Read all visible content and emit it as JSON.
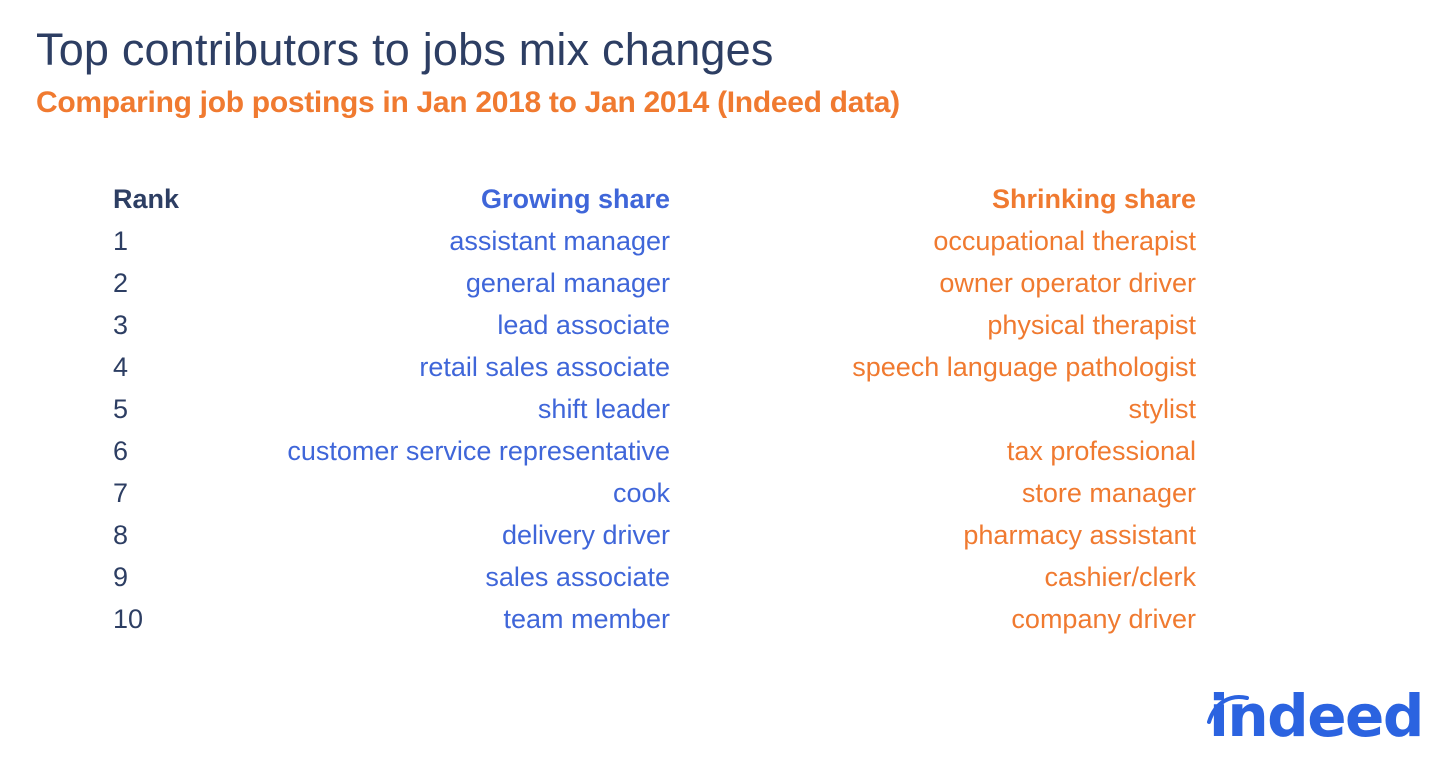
{
  "title": "Top contributors to jobs mix changes",
  "subtitle": "Comparing job postings in Jan 2018 to Jan 2014 (Indeed data)",
  "colors": {
    "title": "#2d3e63",
    "growing": "#3f66d9",
    "shrinking": "#f07a30",
    "logo": "#2b63e0"
  },
  "table": {
    "headers": {
      "rank": "Rank",
      "growing": "Growing share",
      "shrinking": "Shrinking share"
    },
    "rows": [
      {
        "rank": "1",
        "growing": "assistant manager",
        "shrinking": "occupational therapist"
      },
      {
        "rank": "2",
        "growing": "general manager",
        "shrinking": "owner operator driver"
      },
      {
        "rank": "3",
        "growing": "lead associate",
        "shrinking": "physical therapist"
      },
      {
        "rank": "4",
        "growing": "retail sales associate",
        "shrinking": "speech language pathologist"
      },
      {
        "rank": "5",
        "growing": "shift leader",
        "shrinking": "stylist"
      },
      {
        "rank": "6",
        "growing": "customer service representative",
        "shrinking": "tax professional"
      },
      {
        "rank": "7",
        "growing": "cook",
        "shrinking": "store manager"
      },
      {
        "rank": "8",
        "growing": "delivery driver",
        "shrinking": "pharmacy assistant"
      },
      {
        "rank": "9",
        "growing": "sales associate",
        "shrinking": "cashier/clerk"
      },
      {
        "rank": "10",
        "growing": "team member",
        "shrinking": "company driver"
      }
    ]
  },
  "logo": {
    "text": "indeed",
    "icon": "indeed-logo-arc-icon"
  }
}
